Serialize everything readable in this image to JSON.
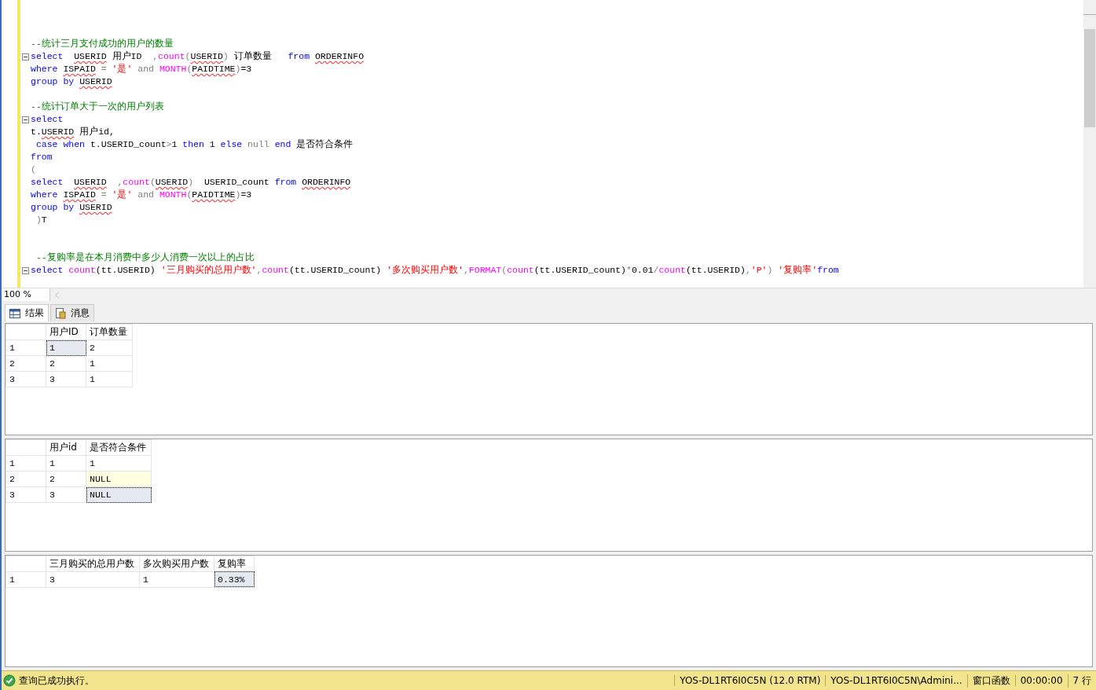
{
  "editor": {
    "lines": [
      {
        "kind": "code",
        "fold": false,
        "tokens": [
          {
            "kind": "comment",
            "text": "--统计三月支付成功的用户的数量"
          }
        ]
      },
      {
        "kind": "code",
        "fold": true,
        "tokens": [
          {
            "kind": "keyword",
            "text": "select  "
          },
          {
            "kind": "ident-error",
            "text": "USERID"
          },
          {
            "kind": "plain",
            "text": " 用户ID  "
          },
          {
            "kind": "operator",
            "text": ","
          },
          {
            "kind": "function",
            "text": "count"
          },
          {
            "kind": "operator",
            "text": "("
          },
          {
            "kind": "ident-error",
            "text": "USERID"
          },
          {
            "kind": "operator",
            "text": ")"
          },
          {
            "kind": "plain",
            "text": " 订单数量   "
          },
          {
            "kind": "keyword",
            "text": "from "
          },
          {
            "kind": "ident-error",
            "text": "ORDERINFO"
          }
        ]
      },
      {
        "kind": "code",
        "fold": false,
        "tokens": [
          {
            "kind": "keyword",
            "text": "where "
          },
          {
            "kind": "ident-error",
            "text": "ISPAID"
          },
          {
            "kind": "operator",
            "text": " = "
          },
          {
            "kind": "string",
            "text": "'是'"
          },
          {
            "kind": "operator",
            "text": " and "
          },
          {
            "kind": "function",
            "text": "MONTH"
          },
          {
            "kind": "operator",
            "text": "("
          },
          {
            "kind": "ident-error",
            "text": "PAIDTIME"
          },
          {
            "kind": "operator",
            "text": ")"
          },
          {
            "kind": "plain",
            "text": "=3"
          }
        ]
      },
      {
        "kind": "code",
        "fold": false,
        "tokens": [
          {
            "kind": "keyword",
            "text": "group by "
          },
          {
            "kind": "ident-error",
            "text": "USERID"
          }
        ]
      },
      {
        "kind": "blank",
        "fold": false
      },
      {
        "kind": "code",
        "fold": false,
        "tokens": [
          {
            "kind": "comment",
            "text": "--统计订单大于一次的用户列表"
          }
        ]
      },
      {
        "kind": "code",
        "fold": true,
        "tokens": [
          {
            "kind": "keyword",
            "text": "select"
          }
        ]
      },
      {
        "kind": "code",
        "fold": false,
        "tokens": [
          {
            "kind": "plain",
            "text": "t."
          },
          {
            "kind": "ident-error",
            "text": "USERID"
          },
          {
            "kind": "plain",
            "text": " 用户id,"
          }
        ]
      },
      {
        "kind": "code",
        "fold": false,
        "tokens": [
          {
            "kind": "keyword",
            "text": " case when "
          },
          {
            "kind": "plain",
            "text": "t.USERID_count"
          },
          {
            "kind": "operator",
            "text": ">"
          },
          {
            "kind": "plain",
            "text": "1 "
          },
          {
            "kind": "keyword",
            "text": "then "
          },
          {
            "kind": "plain",
            "text": "1 "
          },
          {
            "kind": "keyword",
            "text": "else "
          },
          {
            "kind": "operator",
            "text": "null "
          },
          {
            "kind": "keyword",
            "text": "end "
          },
          {
            "kind": "plain",
            "text": "是否符合条件"
          }
        ]
      },
      {
        "kind": "code",
        "fold": false,
        "tokens": [
          {
            "kind": "keyword",
            "text": "from"
          }
        ]
      },
      {
        "kind": "code",
        "fold": false,
        "tokens": [
          {
            "kind": "operator",
            "text": "("
          }
        ]
      },
      {
        "kind": "code",
        "fold": false,
        "tokens": [
          {
            "kind": "keyword",
            "text": "select  "
          },
          {
            "kind": "ident-error",
            "text": "USERID"
          },
          {
            "kind": "operator",
            "text": "  ,"
          },
          {
            "kind": "function",
            "text": "count"
          },
          {
            "kind": "operator",
            "text": "("
          },
          {
            "kind": "ident-error",
            "text": "USERID"
          },
          {
            "kind": "operator",
            "text": ")"
          },
          {
            "kind": "plain",
            "text": "  USERID_count "
          },
          {
            "kind": "keyword",
            "text": "from "
          },
          {
            "kind": "ident-error",
            "text": "ORDERINFO"
          }
        ]
      },
      {
        "kind": "code",
        "fold": false,
        "tokens": [
          {
            "kind": "keyword",
            "text": "where "
          },
          {
            "kind": "ident-error",
            "text": "ISPAID"
          },
          {
            "kind": "operator",
            "text": " = "
          },
          {
            "kind": "string",
            "text": "'是'"
          },
          {
            "kind": "operator",
            "text": " and "
          },
          {
            "kind": "function",
            "text": "MONTH"
          },
          {
            "kind": "operator",
            "text": "("
          },
          {
            "kind": "ident-error",
            "text": "PAIDTIME"
          },
          {
            "kind": "operator",
            "text": ")"
          },
          {
            "kind": "plain",
            "text": "=3"
          }
        ]
      },
      {
        "kind": "code",
        "fold": false,
        "tokens": [
          {
            "kind": "keyword",
            "text": "group by "
          },
          {
            "kind": "ident-error",
            "text": "USERID"
          }
        ]
      },
      {
        "kind": "code",
        "fold": false,
        "tokens": [
          {
            "kind": "operator",
            "text": " )"
          },
          {
            "kind": "plain",
            "text": "T"
          }
        ]
      },
      {
        "kind": "blank",
        "fold": false
      },
      {
        "kind": "blank",
        "fold": false
      },
      {
        "kind": "code",
        "fold": false,
        "tokens": [
          {
            "kind": "comment",
            "text": " --复购率是在本月消费中多少人消费一次以上的占比"
          }
        ]
      },
      {
        "kind": "code",
        "fold": true,
        "tokens": [
          {
            "kind": "keyword",
            "text": "select "
          },
          {
            "kind": "function",
            "text": "count"
          },
          {
            "kind": "plain",
            "text": "(tt.USERID) "
          },
          {
            "kind": "string",
            "text": "'三月购买的总用户数'"
          },
          {
            "kind": "operator",
            "text": ","
          },
          {
            "kind": "function",
            "text": "count"
          },
          {
            "kind": "plain",
            "text": "(tt.USERID_count) "
          },
          {
            "kind": "string",
            "text": "'多次购买用户数'"
          },
          {
            "kind": "operator",
            "text": ","
          },
          {
            "kind": "function",
            "text": "FORMAT"
          },
          {
            "kind": "operator",
            "text": "("
          },
          {
            "kind": "function",
            "text": "count"
          },
          {
            "kind": "plain",
            "text": "(tt.USERID_count)"
          },
          {
            "kind": "operator",
            "text": "*"
          },
          {
            "kind": "plain",
            "text": "0.01"
          },
          {
            "kind": "operator",
            "text": "/"
          },
          {
            "kind": "function",
            "text": "count"
          },
          {
            "kind": "plain",
            "text": "(tt.USERID)"
          },
          {
            "kind": "operator",
            "text": ","
          },
          {
            "kind": "string",
            "text": "'P'"
          },
          {
            "kind": "operator",
            "text": ") "
          },
          {
            "kind": "string",
            "text": "'复购率'"
          },
          {
            "kind": "keyword",
            "text": "from"
          }
        ]
      }
    ]
  },
  "zoom": {
    "value": "100 %"
  },
  "tabs": [
    {
      "label": "结果",
      "selected": true
    },
    {
      "label": "消息",
      "selected": false
    }
  ],
  "grids": [
    {
      "columns": [
        {
          "label": "用户ID"
        },
        {
          "label": "订单数量"
        }
      ],
      "rows": [
        {
          "number": "1",
          "cells": [
            {
              "text": "1",
              "selected": true,
              "null": false
            },
            {
              "text": "2",
              "selected": false,
              "null": false
            }
          ]
        },
        {
          "number": "2",
          "cells": [
            {
              "text": "2",
              "selected": false,
              "null": false
            },
            {
              "text": "1",
              "selected": false,
              "null": false
            }
          ]
        },
        {
          "number": "3",
          "cells": [
            {
              "text": "3",
              "selected": false,
              "null": false
            },
            {
              "text": "1",
              "selected": false,
              "null": false
            }
          ]
        }
      ]
    },
    {
      "columns": [
        {
          "label": "用户id"
        },
        {
          "label": "是否符合条件"
        }
      ],
      "rows": [
        {
          "number": "1",
          "cells": [
            {
              "text": "1",
              "selected": false,
              "null": false
            },
            {
              "text": "1",
              "selected": false,
              "null": false
            }
          ]
        },
        {
          "number": "2",
          "cells": [
            {
              "text": "2",
              "selected": false,
              "null": false
            },
            {
              "text": "NULL",
              "selected": false,
              "null": true
            }
          ]
        },
        {
          "number": "3",
          "cells": [
            {
              "text": "3",
              "selected": false,
              "null": false
            },
            {
              "text": "NULL",
              "selected": true,
              "null": true
            }
          ]
        }
      ]
    },
    {
      "columns": [
        {
          "label": "三月购买的总用户数"
        },
        {
          "label": "多次购买用户数"
        },
        {
          "label": "复购率"
        }
      ],
      "rows": [
        {
          "number": "1",
          "cells": [
            {
              "text": "3",
              "selected": false,
              "null": false
            },
            {
              "text": "1",
              "selected": false,
              "null": false
            },
            {
              "text": "0.33%",
              "selected": true,
              "null": false
            }
          ]
        }
      ]
    }
  ],
  "status_bar": {
    "message": "查询已成功执行。",
    "segments": [
      "YOS-DL1RT6I0C5N (12.0 RTM)",
      "YOS-DL1RT6I0C5N\\Admini...",
      "窗口函数",
      "00:00:00",
      "7 行"
    ]
  }
}
